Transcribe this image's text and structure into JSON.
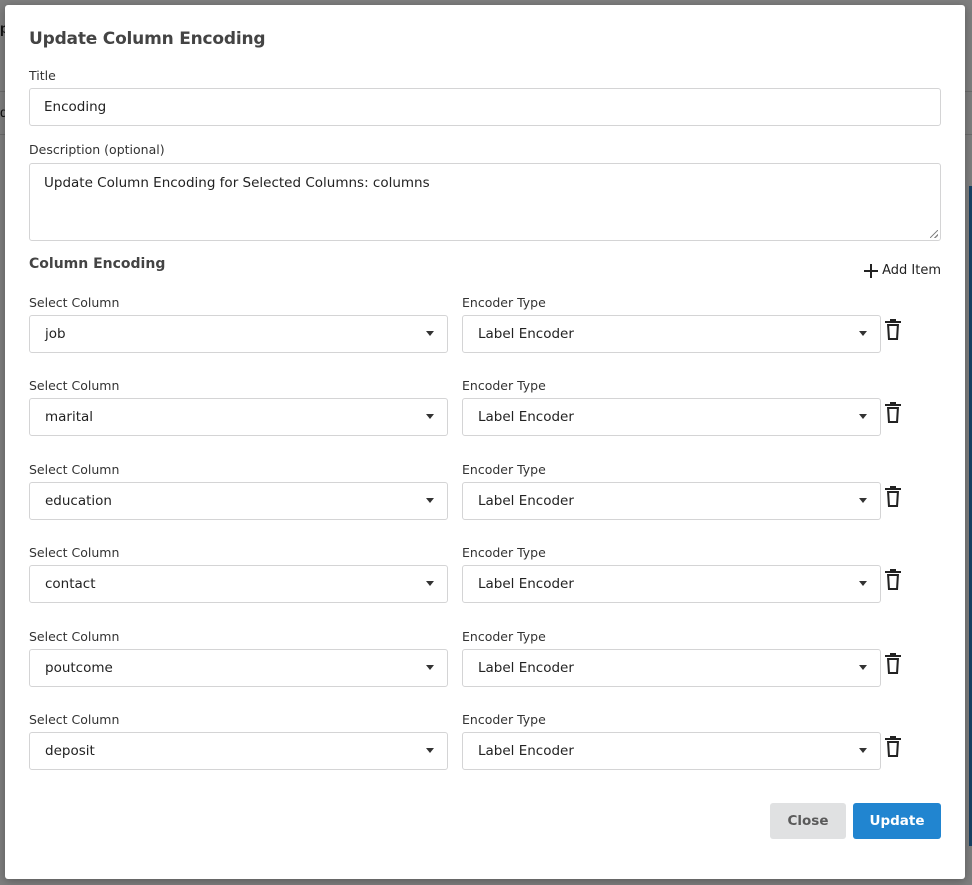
{
  "background": {
    "fragment_top": "p",
    "fragment_mid": "d"
  },
  "modal": {
    "title": "Update Column Encoding",
    "title_field": {
      "label": "Title",
      "value": "Encoding"
    },
    "description_field": {
      "label": "Description (optional)",
      "value": "Update Column Encoding for Selected Columns: columns"
    },
    "section": {
      "title": "Column Encoding",
      "add_item_label": "Add Item"
    },
    "rows": [
      {
        "column_label": "Select Column",
        "column_value": "job",
        "encoder_label": "Encoder Type",
        "encoder_value": "Label Encoder"
      },
      {
        "column_label": "Select Column",
        "column_value": "marital",
        "encoder_label": "Encoder Type",
        "encoder_value": "Label Encoder"
      },
      {
        "column_label": "Select Column",
        "column_value": "education",
        "encoder_label": "Encoder Type",
        "encoder_value": "Label Encoder"
      },
      {
        "column_label": "Select Column",
        "column_value": "contact",
        "encoder_label": "Encoder Type",
        "encoder_value": "Label Encoder"
      },
      {
        "column_label": "Select Column",
        "column_value": "poutcome",
        "encoder_label": "Encoder Type",
        "encoder_value": "Label Encoder"
      },
      {
        "column_label": "Select Column",
        "column_value": "deposit",
        "encoder_label": "Encoder Type",
        "encoder_value": "Label Encoder"
      }
    ],
    "buttons": {
      "close_label": "Close",
      "update_label": "Update"
    }
  },
  "colors": {
    "primary": "#2185d0",
    "secondary": "#e0e1e2",
    "border": "#d4d4d5"
  },
  "icons": {
    "add": "plus-icon",
    "delete": "trash-icon",
    "dropdown": "caret-down-icon"
  }
}
